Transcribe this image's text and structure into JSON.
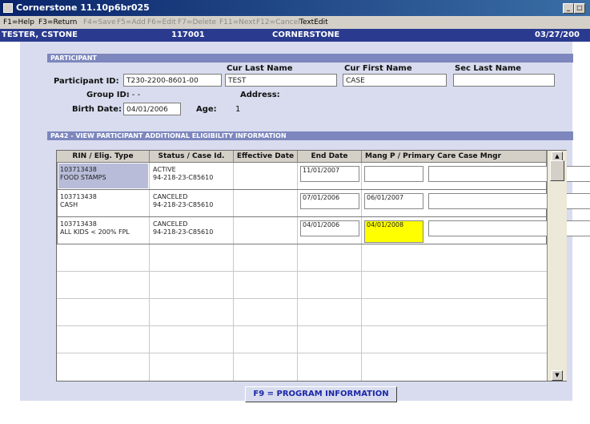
{
  "window": {
    "title": "Cornerstone 11.10p6br025",
    "minimize": "_",
    "maximize": "□"
  },
  "menu": {
    "help": "F1=Help",
    "return": "F3=Return",
    "save": "F4=Save",
    "add": "F5=Add",
    "edit": "F6=Edit",
    "delete": "F7=Delete",
    "next": "F11=Next",
    "cancel": "F12=Cancel",
    "textedit": "TextEdit"
  },
  "info": {
    "user": "TESTER, CSTONE",
    "number": "117001",
    "system": "CORNERSTONE",
    "date": "03/27/200"
  },
  "participant": {
    "header": "PARTICIPANT",
    "id_label": "Participant ID:",
    "id_value": "T230-2200-8601-00",
    "group_label": "Group ID:",
    "group_value": "- - -",
    "birth_label": "Birth Date:",
    "birth_value": "04/01/2006",
    "age_label": "Age:",
    "age_value": "1",
    "last_label": "Cur Last Name",
    "last_value": "TEST",
    "first_label": "Cur First Name",
    "first_value": "CASE",
    "sec_label": "Sec Last Name",
    "sec_value": "",
    "address_label": "Address:"
  },
  "eligibility": {
    "header": "PA42 - VIEW PARTICIPANT ADDITIONAL ELIGIBILITY INFORMATION",
    "columns": [
      "RIN / Elig. Type",
      "Status / Case Id.",
      "Effective Date",
      "End Date",
      "Mang P / Primary Care Case Mngr"
    ],
    "rows": [
      {
        "rin": "103713438",
        "type": "FOOD STAMPS",
        "status": "ACTIVE",
        "case": "94-218-23-C85610",
        "effective": "11/01/2007",
        "end": "",
        "mgr": ""
      },
      {
        "rin": "103713438",
        "type": "CASH",
        "status": "CANCELED",
        "case": "94-218-23-C85610",
        "effective": "07/01/2006",
        "end": "06/01/2007",
        "mgr": ""
      },
      {
        "rin": "103713438",
        "type": "ALL KIDS < 200% FPL",
        "status": "CANCELED",
        "case": "94-218-23-C85610",
        "effective": "04/01/2006",
        "end": "04/01/2008",
        "mgr": ""
      }
    ]
  },
  "scroll": {
    "up": "▲",
    "down": "▼"
  },
  "program_button": "F9 = PROGRAM INFORMATION",
  "colors": {
    "highlight": "#ffff00",
    "selected_row": "#b8bcd8",
    "title_start": "#0a246a",
    "info_bar": "#2a3b8f"
  }
}
